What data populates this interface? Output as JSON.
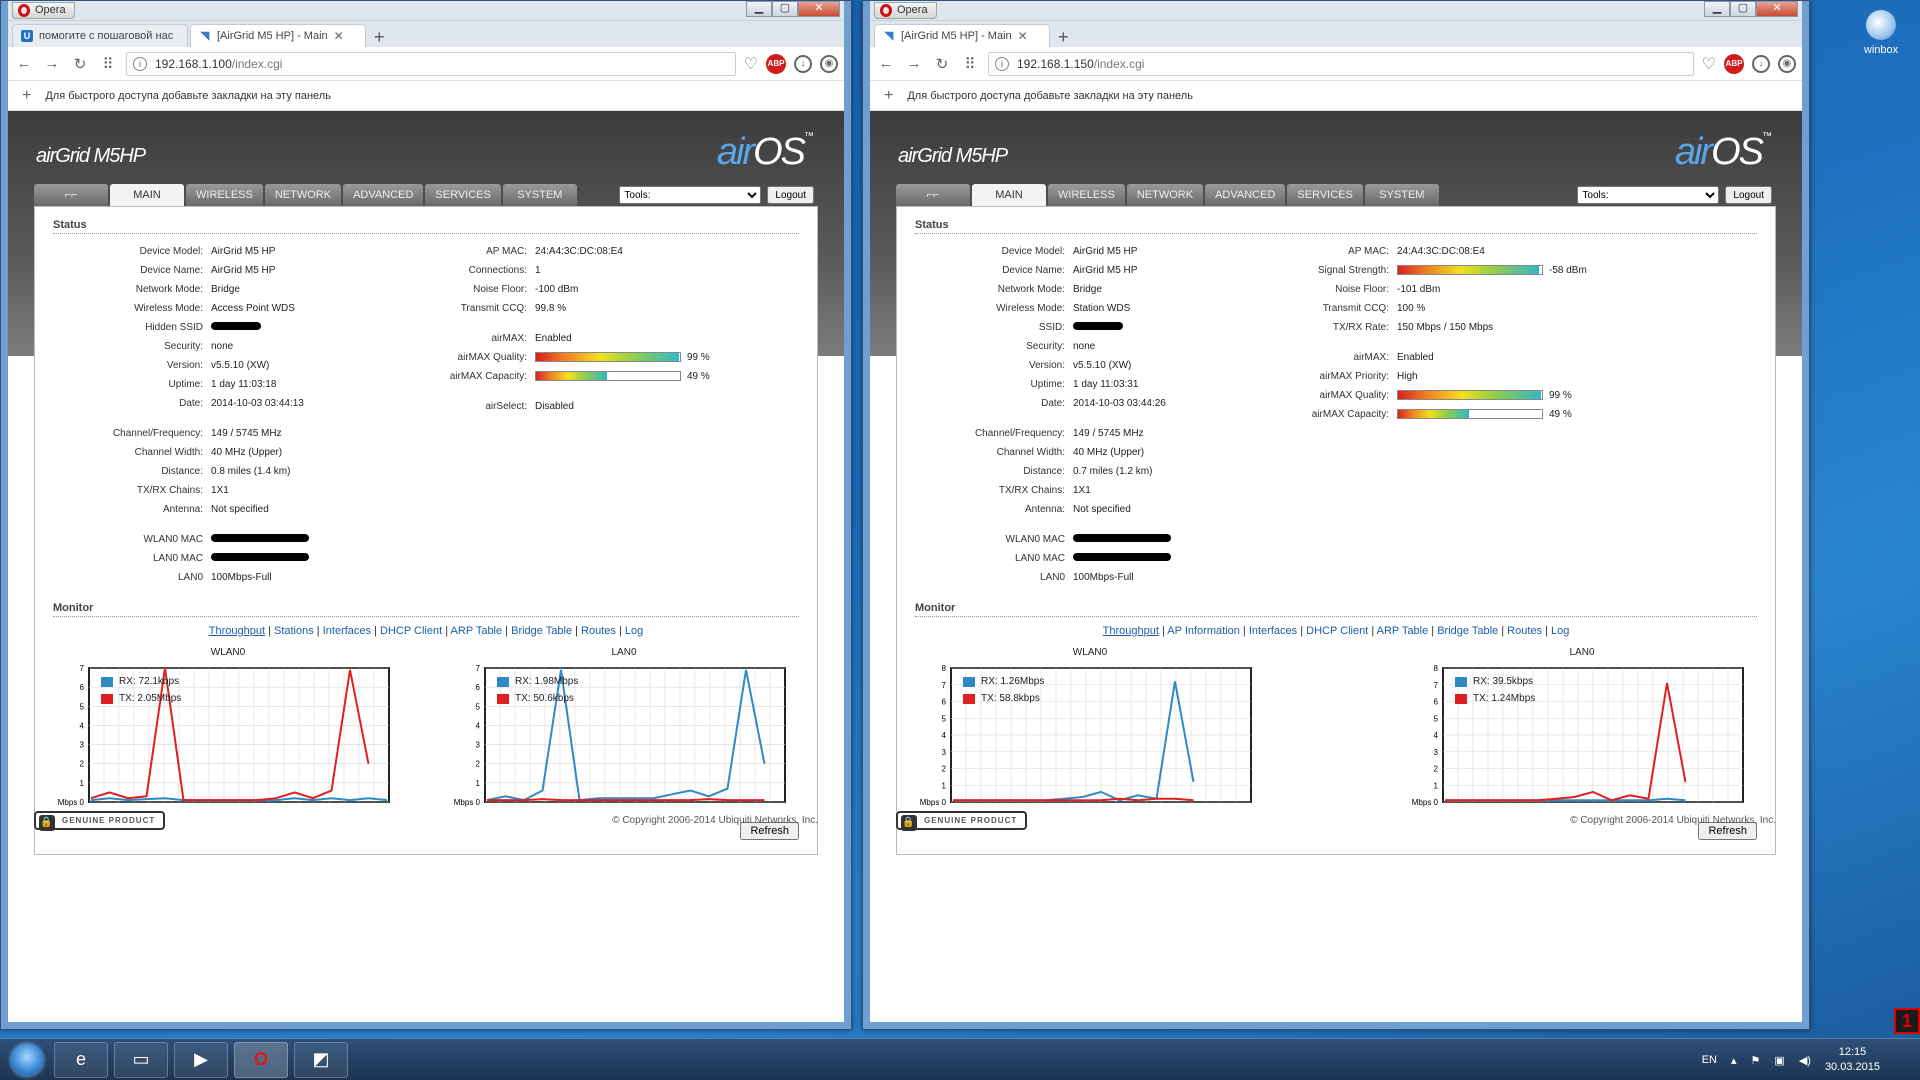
{
  "desktop": {
    "icon_label": "winbox"
  },
  "taskbar": {
    "lang": "EN",
    "time": "12:15",
    "date": "30.03.2015"
  },
  "winA": {
    "opera_label": "Opera",
    "tabs": [
      {
        "title": "помогите с пошаговой нас"
      },
      {
        "title": "[AirGrid M5 HP] - Main"
      }
    ],
    "url_host": "192.168.1.100",
    "url_path": "/index.cgi",
    "bookmark_hint": "Для быстрого доступа добавьте закладки на эту панель",
    "brand": "airGrid M5HP",
    "nav": [
      "MAIN",
      "WIRELESS",
      "NETWORK",
      "ADVANCED",
      "SERVICES",
      "SYSTEM"
    ],
    "tools_label": "Tools:",
    "logout": "Logout",
    "status_title": "Status",
    "left": [
      {
        "k": "Device Model:",
        "v": "AirGrid M5 HP"
      },
      {
        "k": "Device Name:",
        "v": "AirGrid M5 HP"
      },
      {
        "k": "Network Mode:",
        "v": "Bridge"
      },
      {
        "k": "Wireless Mode:",
        "v": "Access Point WDS"
      },
      {
        "k": "Hidden SSID",
        "v": "",
        "blot": true
      },
      {
        "k": "Security:",
        "v": "none"
      },
      {
        "k": "Version:",
        "v": "v5.5.10 (XW)"
      },
      {
        "k": "Uptime:",
        "v": "1 day 11:03:18"
      },
      {
        "k": "Date:",
        "v": "2014-10-03 03:44:13"
      },
      {
        "gap": true
      },
      {
        "k": "Channel/Frequency:",
        "v": "149 / 5745 MHz"
      },
      {
        "k": "Channel Width:",
        "v": "40 MHz (Upper)"
      },
      {
        "k": "Distance:",
        "v": "0.8 miles (1.4 km)"
      },
      {
        "k": "TX/RX Chains:",
        "v": "1X1"
      },
      {
        "k": "Antenna:",
        "v": "Not specified"
      },
      {
        "gap": true
      },
      {
        "k": "WLAN0 MAC",
        "v": "",
        "blot": "w"
      },
      {
        "k": "LAN0 MAC",
        "v": "",
        "blot": "w"
      },
      {
        "k": "LAN0",
        "v": "100Mbps-Full"
      }
    ],
    "right": [
      {
        "k": "AP MAC:",
        "v": "24:A4:3C:DC:08:E4"
      },
      {
        "k": "Connections:",
        "v": "1"
      },
      {
        "k": "Noise Floor:",
        "v": "-100 dBm"
      },
      {
        "k": "Transmit CCQ:",
        "v": "99.8 %"
      },
      {
        "gap": true
      },
      {
        "k": "airMAX:",
        "v": "Enabled"
      },
      {
        "k": "airMAX Quality:",
        "v": "99 %",
        "bar": 0.99
      },
      {
        "k": "airMAX Capacity:",
        "v": "49 %",
        "bar": 0.49
      },
      {
        "gap": true
      },
      {
        "k": "airSelect:",
        "v": "Disabled"
      }
    ],
    "monitor_title": "Monitor",
    "links": [
      "Throughput",
      "Stations",
      "Interfaces",
      "DHCP Client",
      "ARP Table",
      "Bridge Table",
      "Routes",
      "Log"
    ],
    "graphs": [
      {
        "title": "WLAN0",
        "ymax": 7,
        "unit": "Mbps",
        "rx": "RX: 72.1kbps",
        "tx": "TX: 2.05Mbps",
        "rx_vals": [
          0.1,
          0.2,
          0.1,
          0.15,
          0.2,
          0.1,
          0.1,
          0.1,
          0.1,
          0.1,
          0.1,
          0.2,
          0.1,
          0.2,
          0.1,
          0.2,
          0.1
        ],
        "tx_vals": [
          0.2,
          0.5,
          0.2,
          0.3,
          7.0,
          0.1,
          0.1,
          0.1,
          0.1,
          0.1,
          0.2,
          0.5,
          0.2,
          0.6,
          6.9,
          2.0,
          null
        ]
      },
      {
        "title": "LAN0",
        "ymax": 7,
        "unit": "Mbps",
        "rx": "RX: 1.98Mbps",
        "tx": "TX: 50.6kbps",
        "rx_vals": [
          0.1,
          0.3,
          0.1,
          0.6,
          6.9,
          0.1,
          0.2,
          0.2,
          0.2,
          0.2,
          0.4,
          0.6,
          0.3,
          0.7,
          6.9,
          2.0,
          null
        ],
        "tx_vals": [
          0.1,
          0.1,
          0.1,
          0.15,
          0.1,
          0.1,
          0.1,
          0.1,
          0.1,
          0.1,
          0.1,
          0.1,
          0.15,
          0.1,
          0.1,
          0.1,
          null
        ]
      }
    ],
    "refresh": "Refresh",
    "genuine": "GENUINE PRODUCT",
    "copyright": "© Copyright 2006-2014 Ubiquiti Networks, Inc."
  },
  "winB": {
    "opera_label": "Opera",
    "tabs": [
      {
        "title": "[AirGrid M5 HP] - Main"
      }
    ],
    "url_host": "192.168.1.150",
    "url_path": "/index.cgi",
    "bookmark_hint": "Для быстрого доступа добавьте закладки на эту панель",
    "brand": "airGrid M5HP",
    "nav": [
      "MAIN",
      "WIRELESS",
      "NETWORK",
      "ADVANCED",
      "SERVICES",
      "SYSTEM"
    ],
    "tools_label": "Tools:",
    "logout": "Logout",
    "status_title": "Status",
    "left": [
      {
        "k": "Device Model:",
        "v": "AirGrid M5 HP"
      },
      {
        "k": "Device Name:",
        "v": "AirGrid M5 HP"
      },
      {
        "k": "Network Mode:",
        "v": "Bridge"
      },
      {
        "k": "Wireless Mode:",
        "v": "Station WDS"
      },
      {
        "k": "SSID:",
        "v": "",
        "blot": true
      },
      {
        "k": "Security:",
        "v": "none"
      },
      {
        "k": "Version:",
        "v": "v5.5.10 (XW)"
      },
      {
        "k": "Uptime:",
        "v": "1 day 11:03:31"
      },
      {
        "k": "Date:",
        "v": "2014-10-03 03:44:26"
      },
      {
        "gap": true
      },
      {
        "k": "Channel/Frequency:",
        "v": "149 / 5745 MHz"
      },
      {
        "k": "Channel Width:",
        "v": "40 MHz (Upper)"
      },
      {
        "k": "Distance:",
        "v": "0.7 miles (1.2 km)"
      },
      {
        "k": "TX/RX Chains:",
        "v": "1X1"
      },
      {
        "k": "Antenna:",
        "v": "Not specified"
      },
      {
        "gap": true
      },
      {
        "k": "WLAN0 MAC",
        "v": "",
        "blot": "w"
      },
      {
        "k": "LAN0 MAC",
        "v": "",
        "blot": "w"
      },
      {
        "k": "LAN0",
        "v": "100Mbps-Full"
      }
    ],
    "right": [
      {
        "k": "AP MAC:",
        "v": "24:A4:3C:DC:08:E4"
      },
      {
        "k": "Signal Strength:",
        "v": "-58 dBm",
        "bar": 0.98
      },
      {
        "k": "Noise Floor:",
        "v": "-101 dBm"
      },
      {
        "k": "Transmit CCQ:",
        "v": "100 %"
      },
      {
        "k": "TX/RX Rate:",
        "v": "150 Mbps / 150 Mbps"
      },
      {
        "gap": true
      },
      {
        "k": "airMAX:",
        "v": "Enabled"
      },
      {
        "k": "airMAX Priority:",
        "v": "High"
      },
      {
        "k": "airMAX Quality:",
        "v": "99 %",
        "bar": 0.99
      },
      {
        "k": "airMAX Capacity:",
        "v": "49 %",
        "bar": 0.49
      }
    ],
    "monitor_title": "Monitor",
    "links": [
      "Throughput",
      "AP Information",
      "Interfaces",
      "DHCP Client",
      "ARP Table",
      "Bridge Table",
      "Routes",
      "Log"
    ],
    "graphs": [
      {
        "title": "WLAN0",
        "ymax": 8,
        "unit": "Mbps",
        "rx": "RX: 1.26Mbps",
        "tx": "TX: 58.8kbps",
        "rx_vals": [
          0.1,
          0.1,
          0.1,
          0.1,
          0.1,
          0.1,
          0.2,
          0.3,
          0.6,
          0.1,
          0.4,
          0.2,
          7.2,
          1.2,
          null,
          null,
          null
        ],
        "tx_vals": [
          0.1,
          0.1,
          0.1,
          0.1,
          0.1,
          0.1,
          0.1,
          0.1,
          0.1,
          0.2,
          0.1,
          0.2,
          0.2,
          0.1,
          null,
          null,
          null
        ]
      },
      {
        "title": "LAN0",
        "ymax": 8,
        "unit": "Mbps",
        "rx": "RX: 39.5kbps",
        "tx": "TX: 1.24Mbps",
        "rx_vals": [
          0.1,
          0.1,
          0.1,
          0.1,
          0.1,
          0.1,
          0.1,
          0.1,
          0.1,
          0.1,
          0.1,
          0.1,
          0.2,
          0.1,
          null,
          null,
          null
        ],
        "tx_vals": [
          0.1,
          0.1,
          0.1,
          0.1,
          0.1,
          0.1,
          0.2,
          0.3,
          0.6,
          0.1,
          0.4,
          0.2,
          7.1,
          1.2,
          null,
          null,
          null
        ]
      }
    ],
    "refresh": "Refresh",
    "genuine": "GENUINE PRODUCT",
    "copyright": "© Copyright 2006-2014 Ubiquiti Networks, Inc."
  },
  "colors": {
    "rx": "#2f8ac4",
    "tx": "#e02020",
    "grid": "#d8d8d8"
  }
}
